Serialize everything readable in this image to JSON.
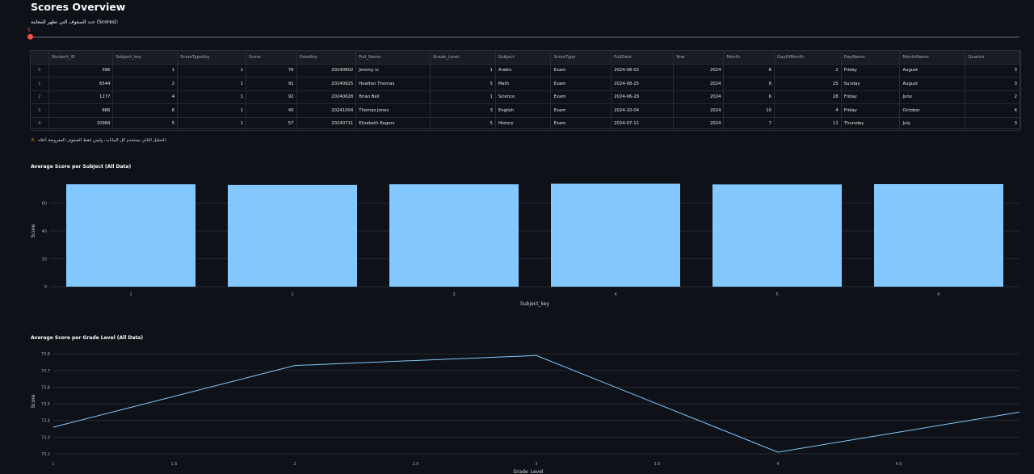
{
  "page": {
    "title": "Scores Overview",
    "slider_label": "حدد الصفوف التي تظهر للمعاينة (Scores):",
    "slider_value": "5",
    "warning_text": "التحليل التالي يستخدم كل البيانات، وليس فقط الصفوف المعروضة أعلاه."
  },
  "table": {
    "columns": [
      "",
      "Student_ID",
      "Subject_key",
      "ScoreTypeKey",
      "Score",
      "DateKey",
      "Full_Name",
      "Grade_Level",
      "Subject",
      "ScoreType",
      "FullDate",
      "Year",
      "Month",
      "DayOfMonth",
      "DayName",
      "MonthName",
      "Quarter"
    ],
    "rows": [
      [
        "0",
        "396",
        "1",
        "1",
        "76",
        "20240802",
        "Jeremy Li",
        "1",
        "Arabic",
        "Exam",
        "2024-08-02",
        "2024",
        "8",
        "2",
        "Friday",
        "August",
        "3"
      ],
      [
        "1",
        "6544",
        "2",
        "1",
        "91",
        "20240825",
        "Heather Thomas",
        "5",
        "Math",
        "Exam",
        "2024-08-25",
        "2024",
        "8",
        "25",
        "Sunday",
        "August",
        "3"
      ],
      [
        "2",
        "1277",
        "4",
        "1",
        "92",
        "20240628",
        "Brian Bell",
        "1",
        "Science",
        "Exam",
        "2024-06-28",
        "2024",
        "6",
        "28",
        "Friday",
        "June",
        "2"
      ],
      [
        "3",
        "686",
        "6",
        "1",
        "40",
        "20241004",
        "Thomas Jones",
        "3",
        "English",
        "Exam",
        "2024-10-04",
        "2024",
        "10",
        "4",
        "Friday",
        "October",
        "4"
      ],
      [
        "4",
        "10984",
        "5",
        "1",
        "57",
        "20240711",
        "Elizabeth Rogers",
        "5",
        "History",
        "Exam",
        "2024-07-11",
        "2024",
        "7",
        "11",
        "Thursday",
        "July",
        "3"
      ]
    ]
  },
  "chart_data": [
    {
      "type": "bar",
      "title": "Average Score per Subject (All Data)",
      "xlabel": "Subject_key",
      "ylabel": "Score",
      "categories": [
        "1",
        "2",
        "3",
        "4",
        "5",
        "6"
      ],
      "values": [
        73.5,
        73.1,
        73.5,
        73.9,
        73.4,
        73.6
      ],
      "ylim": [
        0,
        80
      ],
      "yticks": [
        "0",
        "20",
        "40",
        "60"
      ],
      "color": "#83c9ff"
    },
    {
      "type": "line",
      "title": "Average Score per Grade Level (All Data)",
      "xlabel": "Grade_Level",
      "ylabel": "Score",
      "x": [
        1,
        2,
        3,
        4,
        5
      ],
      "y": [
        73.36,
        73.73,
        73.79,
        73.21,
        73.45
      ],
      "xlim": [
        1,
        5
      ],
      "ylim": [
        73.2,
        73.83
      ],
      "xticks": [
        "1",
        "1.5",
        "2",
        "2.5",
        "3",
        "3.5",
        "4",
        "4.5"
      ],
      "yticks": [
        "73.2",
        "73.3",
        "73.4",
        "73.5",
        "73.6",
        "73.7",
        "73.8"
      ],
      "color": "#83c9ff"
    }
  ]
}
